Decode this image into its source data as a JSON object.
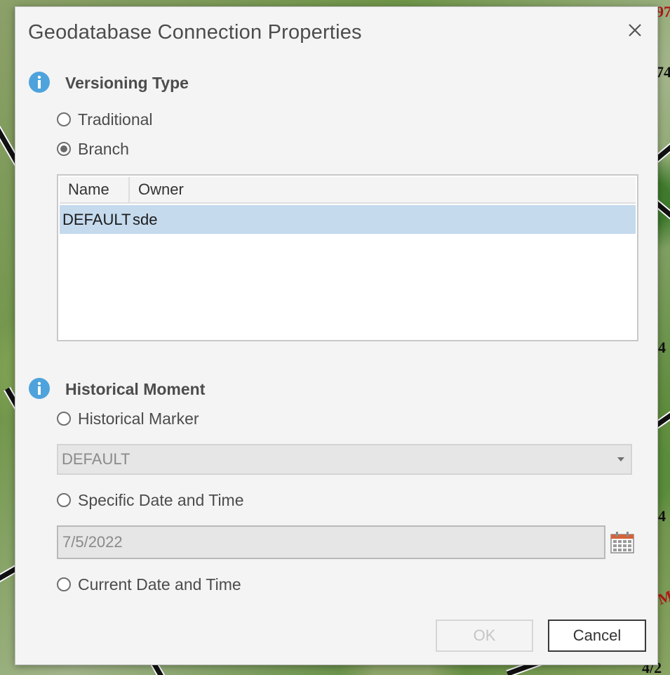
{
  "background": {
    "labels": [
      {
        "text": "97",
        "color": "red"
      },
      {
        "text": "74",
        "color": "black"
      },
      {
        "text": "4",
        "color": "black"
      },
      {
        "text": "4",
        "color": "black"
      },
      {
        "text": "M",
        "color": "red"
      },
      {
        "text": "4/2",
        "color": "black"
      }
    ]
  },
  "dialog": {
    "title": "Geodatabase Connection Properties",
    "close_icon": "close-icon"
  },
  "versioning": {
    "section_title": "Versioning Type",
    "options": [
      {
        "label": "Traditional",
        "checked": false
      },
      {
        "label": "Branch",
        "checked": true
      }
    ],
    "table": {
      "columns": [
        "Name",
        "Owner"
      ],
      "rows": [
        {
          "name": "DEFAULT",
          "owner": "sde",
          "selected": true
        }
      ]
    }
  },
  "historical": {
    "section_title": "Historical Moment",
    "marker_option": {
      "label": "Historical Marker",
      "checked": false
    },
    "marker_value": "DEFAULT",
    "date_option": {
      "label": "Specific Date and Time",
      "checked": false
    },
    "date_value": "7/5/2022",
    "current_option": {
      "label": "Current Date and Time",
      "checked": false
    }
  },
  "buttons": {
    "ok": "OK",
    "cancel": "Cancel"
  },
  "colors": {
    "accent_info": "#4ea3dc",
    "selection": "#c5daed",
    "calendar": "#d4623b"
  }
}
